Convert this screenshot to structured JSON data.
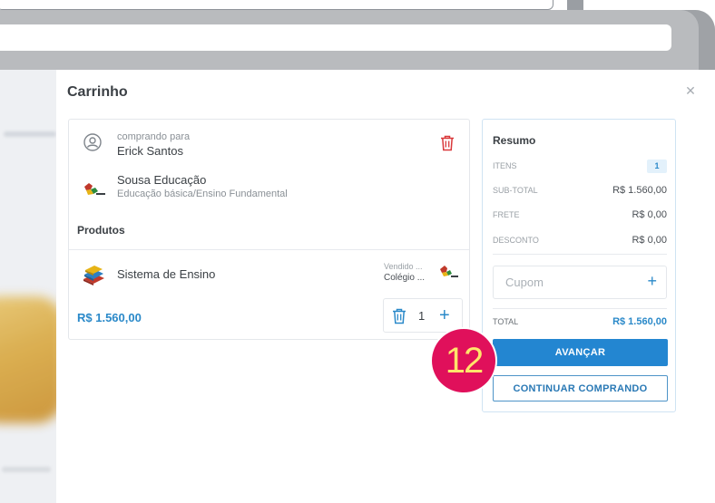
{
  "drawer": {
    "title": "Carrinho"
  },
  "buyer": {
    "label": "comprando para",
    "name": "Erick Santos"
  },
  "school": {
    "name": "Sousa Educação",
    "segment": "Educação básica/Ensino Fundamental"
  },
  "products": {
    "title": "Produtos",
    "items": [
      {
        "name": "Sistema de Ensino",
        "vendor_label": "Vendido ...",
        "vendor_name": "Colégio ...",
        "price": "R$ 1.560,00",
        "quantity": "1"
      }
    ]
  },
  "summary": {
    "title": "Resumo",
    "rows": [
      {
        "key": "ITENS",
        "value": "1"
      },
      {
        "key": "SUB-TOTAL",
        "value": "R$ 1.560,00"
      },
      {
        "key": "FRETE",
        "value": "R$ 0,00"
      },
      {
        "key": "DESCONTO",
        "value": "R$ 0,00"
      }
    ],
    "coupon_placeholder": "Cupom",
    "total_label": "TOTAL",
    "total_value": "R$ 1.560,00",
    "primary_button": "AVANÇAR",
    "secondary_button": "CONTINUAR COMPRANDO"
  },
  "step_marker": "12",
  "colors": {
    "accent": "#2386d1",
    "price": "#2a89c9",
    "delete": "#d9383a",
    "marker": "#e0105b",
    "marker_text": "#ffe56b"
  },
  "icons": [
    "user-circle-icon",
    "trash-icon",
    "school-logo-icon",
    "books-icon",
    "plus-icon",
    "close-icon"
  ]
}
